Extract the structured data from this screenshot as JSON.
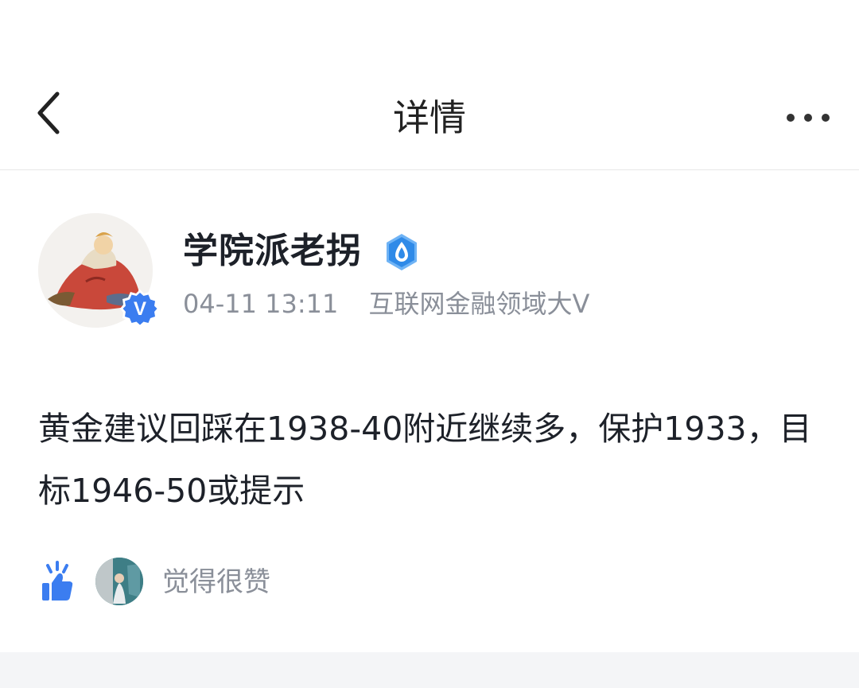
{
  "header": {
    "title": "详情"
  },
  "author": {
    "name": "学院派老拐",
    "time": "04-11 13:11",
    "tag": "互联网金融领域大V",
    "verified_mark": "V"
  },
  "post": {
    "content": "黄金建议回踩在1938-40附近继续多，保护1933，目标1946-50或提示"
  },
  "reactions": {
    "like_text": "觉得很赞"
  },
  "colors": {
    "accent_blue": "#3b7df0",
    "text_primary": "#1d2129",
    "text_secondary": "#8a8f99",
    "divider": "#e8e8e8",
    "footer_bg": "#f4f5f7"
  },
  "icons": {
    "back": "chevron-left-icon",
    "more": "ellipsis-icon",
    "verified": "verified-v-badge-icon",
    "water": "water-drop-badge-icon",
    "like": "thumbs-up-icon"
  }
}
